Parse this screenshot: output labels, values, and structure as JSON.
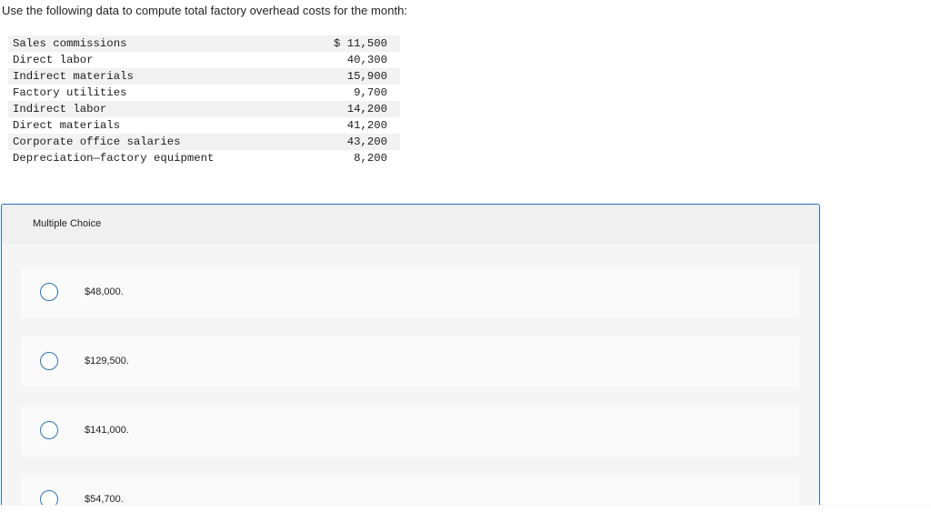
{
  "question": {
    "text": "Use the following data to compute total factory overhead costs for the month:"
  },
  "cost_table": {
    "rows": [
      {
        "label": "Sales commissions",
        "value": "$ 11,500"
      },
      {
        "label": "Direct labor",
        "value": "40,300"
      },
      {
        "label": "Indirect materials",
        "value": "15,900"
      },
      {
        "label": "Factory utilities",
        "value": "9,700"
      },
      {
        "label": "Indirect labor",
        "value": "14,200"
      },
      {
        "label": "Direct materials",
        "value": "41,200"
      },
      {
        "label": "Corporate office salaries",
        "value": "43,200"
      },
      {
        "label": "Depreciation—factory equipment",
        "value": "8,200"
      }
    ]
  },
  "multiple_choice": {
    "title": "Multiple Choice",
    "options": [
      {
        "label": "$48,000."
      },
      {
        "label": "$129,500."
      },
      {
        "label": "$141,000."
      },
      {
        "label": "$54,700."
      }
    ]
  },
  "colors": {
    "accent": "#2f73bd",
    "panel_border": "#2a6db5",
    "panel_bg": "#f5f5f5",
    "row_stripe": "#f2f2f2"
  }
}
